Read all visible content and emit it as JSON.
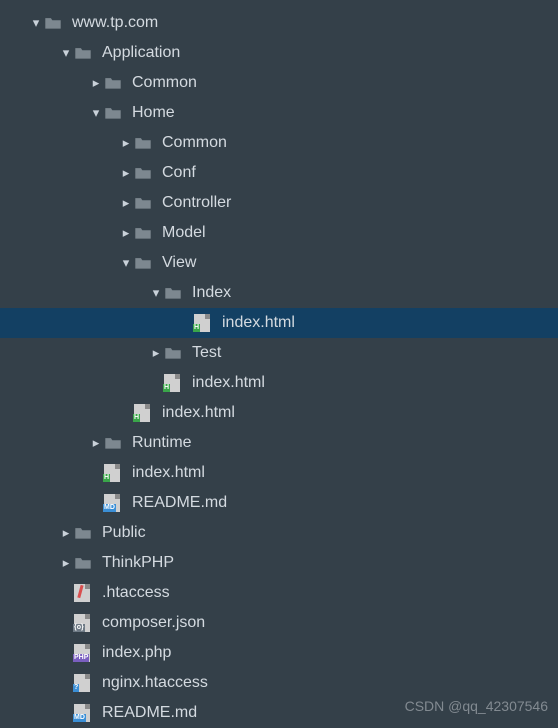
{
  "tree": {
    "root": "www.tp.com",
    "application": "Application",
    "common1": "Common",
    "home": "Home",
    "common2": "Common",
    "conf": "Conf",
    "controller": "Controller",
    "model": "Model",
    "view": "View",
    "index_folder": "Index",
    "index_html_sel": "index.html",
    "test": "Test",
    "index_html_2": "index.html",
    "index_html_3": "index.html",
    "runtime": "Runtime",
    "index_html_4": "index.html",
    "readme1": "README.md",
    "public": "Public",
    "thinkphp": "ThinkPHP",
    "htaccess": ".htaccess",
    "composer": "composer.json",
    "index_php": "index.php",
    "nginx": "nginx.htaccess",
    "readme2": "README.md"
  },
  "watermark": "CSDN @qq_42307546"
}
